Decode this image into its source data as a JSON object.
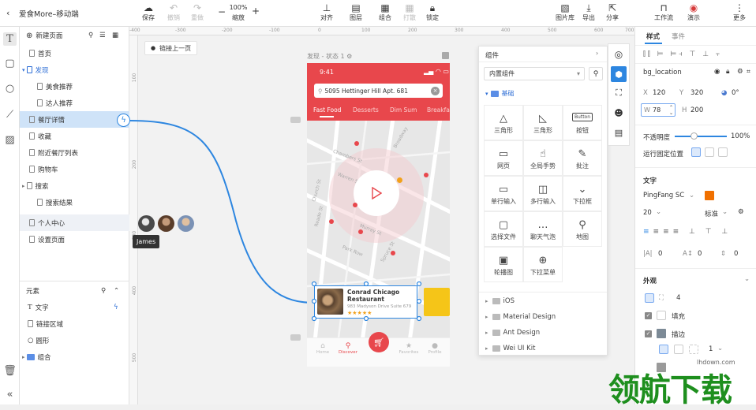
{
  "app": {
    "title": "爱食More–移动端"
  },
  "toolbar": {
    "save": "保存",
    "undo": "撤销",
    "redo": "重做",
    "zoom_value": "100%",
    "zoom_label": "缩放",
    "align": "对齐",
    "layers": "图层",
    "group": "组合",
    "ungroup": "打散",
    "lock": "锁定",
    "image_library": "图片库",
    "export": "导出",
    "share": "分享",
    "workflow": "工作流",
    "present": "演示",
    "more": "更多"
  },
  "pages": {
    "new_page": "新建页面",
    "items": [
      {
        "label": "首页"
      },
      {
        "label": "发现"
      },
      {
        "label": "美食推荐"
      },
      {
        "label": "达人推荐"
      },
      {
        "label": "餐厅详情"
      },
      {
        "label": "收藏"
      },
      {
        "label": "附近餐厅列表"
      },
      {
        "label": "购物车"
      },
      {
        "label": "搜索"
      },
      {
        "label": "搜索结果"
      },
      {
        "label": "个人中心"
      },
      {
        "label": "设置页面"
      }
    ]
  },
  "elements": {
    "title": "元素",
    "items": [
      {
        "label": "文字"
      },
      {
        "label": "链接区域"
      },
      {
        "label": "圆形"
      },
      {
        "label": "组合"
      }
    ]
  },
  "canvas": {
    "link_prev": "链接上一页",
    "frame_label": "发现 - 状态 1",
    "tooltip_user": "James",
    "ruler_x": [
      "-400",
      "-300",
      "-200",
      "-100",
      "0",
      "100",
      "200",
      "300",
      "400",
      "500",
      "600",
      "700",
      "800"
    ],
    "ruler_y": [
      "100",
      "200",
      "300",
      "400",
      "500"
    ]
  },
  "phone": {
    "time": "9:41",
    "search_text": "5095 Hettinger Hill Apt. 681",
    "tabs": [
      "Fast Food",
      "Desserts",
      "Dim Sum",
      "Breakfa"
    ],
    "map_labels": [
      "Chambers St",
      "Warren St",
      "Murray St",
      "Park Row",
      "Spruce St",
      "Broadway",
      "Church St",
      "Reade St"
    ],
    "card_title_1": "Conrad Chicago",
    "card_title_2": "Restaurant",
    "card_address": "983 Madyson Drive Suite 679",
    "card_stars": "★★★★★",
    "nav": [
      "Home",
      "Discover",
      "Favorites",
      "Profile"
    ]
  },
  "components": {
    "title": "组件",
    "library_select": "内置组件",
    "category": "基础",
    "items": [
      {
        "label": "三角形",
        "glyph": "△"
      },
      {
        "label": "三角形",
        "glyph": "◺"
      },
      {
        "label": "按钮",
        "glyph": "Button"
      },
      {
        "label": "网页",
        "glyph": "▭"
      },
      {
        "label": "全局手势",
        "glyph": "☝"
      },
      {
        "label": "批注",
        "glyph": "✎"
      },
      {
        "label": "单行输入",
        "glyph": "▭"
      },
      {
        "label": "多行输入",
        "glyph": "◫"
      },
      {
        "label": "下拉框",
        "glyph": "⌄"
      },
      {
        "label": "选择文件",
        "glyph": "▢"
      },
      {
        "label": "聊天气泡",
        "glyph": "…"
      },
      {
        "label": "地图",
        "glyph": "⚲"
      },
      {
        "label": "轮播图",
        "glyph": "▣"
      },
      {
        "label": "下拉菜单",
        "glyph": "⊕"
      }
    ],
    "libraries": [
      "iOS",
      "Material Design",
      "Ant Design",
      "Wei UI Kit"
    ]
  },
  "inspector": {
    "tab_style": "样式",
    "tab_event": "事件",
    "layer_name": "bg_location",
    "x_label": "X",
    "x_value": "120",
    "y_label": "Y",
    "y_value": "320",
    "rotation": "0°",
    "w_label": "W",
    "w_value": "78",
    "h_label": "H",
    "h_value": "200",
    "opacity_label": "不透明度",
    "opacity_value": "100%",
    "fixed_label": "运行固定位置",
    "text_title": "文字",
    "font_family": "PingFang SC",
    "font_size": "20",
    "font_weight": "标准",
    "text_color": "#f07000",
    "spacing_1": "0",
    "spacing_2": "0",
    "spacing_3": "0",
    "appearance_title": "外观",
    "corner_value": "4",
    "fill_label": "填充",
    "stroke_label": "描边",
    "stroke_width": "1"
  },
  "watermark": {
    "text": "领航下载",
    "site": "lhdown.com"
  }
}
